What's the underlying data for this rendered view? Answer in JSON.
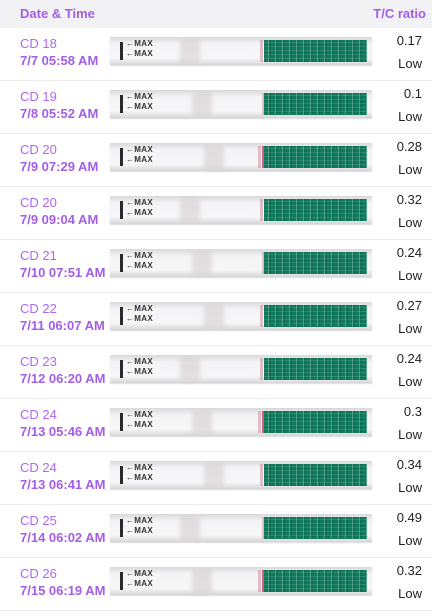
{
  "header": {
    "left_label": "Date & Time",
    "right_label": "T/C ratio"
  },
  "strip": {
    "max_label": "←MAX",
    "colors": {
      "control_line": "#cd4669",
      "dye_pad": "#0f7a5c"
    }
  },
  "rows": [
    {
      "cd": "CD 18",
      "datetime": "7/7  05:58 AM",
      "ratio": "0.17",
      "status": "Low"
    },
    {
      "cd": "CD 19",
      "datetime": "7/8  05:52 AM",
      "ratio": "0.1",
      "status": "Low"
    },
    {
      "cd": "CD 20",
      "datetime": "7/9  07:29 AM",
      "ratio": "0.28",
      "status": "Low"
    },
    {
      "cd": "CD 20",
      "datetime": "7/9  09:04 AM",
      "ratio": "0.32",
      "status": "Low"
    },
    {
      "cd": "CD 21",
      "datetime": "7/10  07:51 AM",
      "ratio": "0.24",
      "status": "Low"
    },
    {
      "cd": "CD 22",
      "datetime": "7/11  06:07 AM",
      "ratio": "0.27",
      "status": "Low"
    },
    {
      "cd": "CD 23",
      "datetime": "7/12  06:20 AM",
      "ratio": "0.24",
      "status": "Low"
    },
    {
      "cd": "CD 24",
      "datetime": "7/13  05:46 AM",
      "ratio": "0.3",
      "status": "Low"
    },
    {
      "cd": "CD 24",
      "datetime": "7/13  06:41 AM",
      "ratio": "0.34",
      "status": "Low"
    },
    {
      "cd": "CD 25",
      "datetime": "7/14  06:02 AM",
      "ratio": "0.49",
      "status": "Low"
    },
    {
      "cd": "CD 26",
      "datetime": "7/15  06:19 AM",
      "ratio": "0.32",
      "status": "Low"
    }
  ]
}
